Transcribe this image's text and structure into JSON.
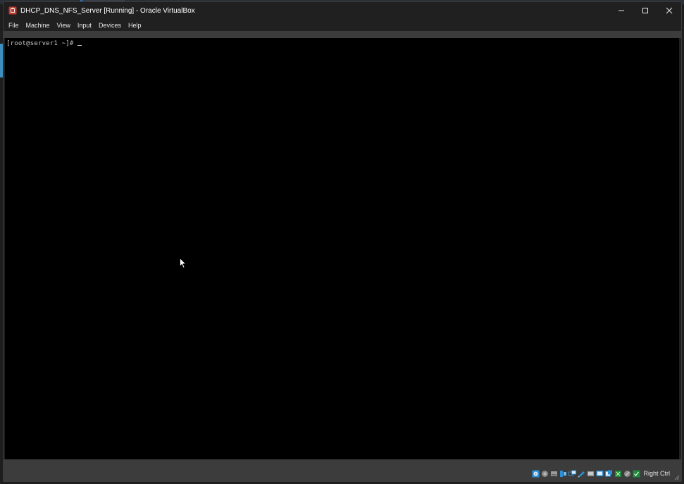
{
  "window": {
    "title": "DHCP_DNS_NFS_Server [Running] - Oracle VirtualBox"
  },
  "menu": [
    "File",
    "Machine",
    "View",
    "Input",
    "Devices",
    "Help"
  ],
  "console": {
    "prompt": "[root@server1 ~]# "
  },
  "statusbar": {
    "host_key": "Right Ctrl",
    "icons": [
      "optical-drive-icon",
      "audio-icon",
      "hard-disk-icon",
      "usb-icon",
      "network-icon",
      "shared-folders-icon",
      "display-icon",
      "video-capture-icon",
      "guest-additions-icon",
      "mouse-integration-icon",
      "cpu-icon",
      "keyboard-icon"
    ]
  },
  "colors": {
    "console_bg": "#000000",
    "chrome_bg": "#202020",
    "statusbar_bg": "#3c3c3c",
    "accent_blue": "#2d8fd5"
  }
}
